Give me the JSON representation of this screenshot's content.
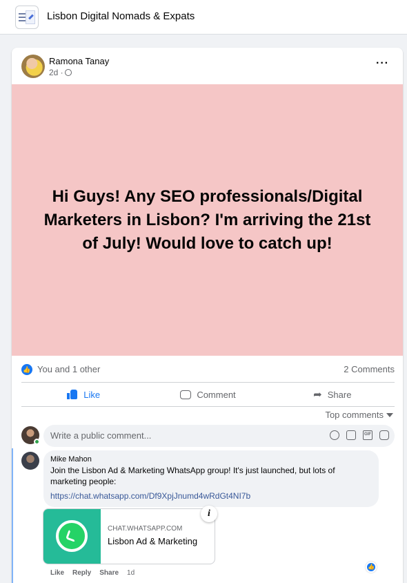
{
  "group": {
    "name": "Lisbon Digital Nomads & Expats"
  },
  "post": {
    "author": "Ramona Tanay",
    "time": "2d ·",
    "text": "Hi Guys! Any SEO professionals/Digital Marketers in Lisbon? I'm arriving the 21st of July! Would love to catch up!",
    "background_color": "#f5c6c6",
    "more_label": "···"
  },
  "stats": {
    "likes": "You and 1 other",
    "comments": "2 Comments"
  },
  "actions": {
    "like": "Like",
    "comment": "Comment",
    "share": "Share"
  },
  "comments_sort": "Top comments",
  "composer": {
    "placeholder": "Write a public comment..."
  },
  "reply": {
    "author": "Mike Mahon",
    "text": "Join the Lisbon Ad & Marketing WhatsApp group! It's just launched, but lots of marketing people:",
    "link": "https://chat.whatsapp.com/Df9XpjJnumd4wRdGt4NI7b",
    "preview": {
      "domain": "CHAT.WHATSAPP.COM",
      "title": "Lisbon Ad & Marketing",
      "info": "i"
    },
    "actions": {
      "like": "Like",
      "reply": "Reply",
      "share": "Share",
      "time": "1d"
    }
  },
  "colors": {
    "accent": "#1877f2",
    "whatsapp": "#25bb98"
  },
  "icons": [
    "like-icon",
    "comment-icon",
    "share-icon",
    "globe-icon",
    "emoji-icon",
    "camera-icon",
    "gif-icon",
    "sticker-icon",
    "whatsapp-icon",
    "info-icon"
  ]
}
